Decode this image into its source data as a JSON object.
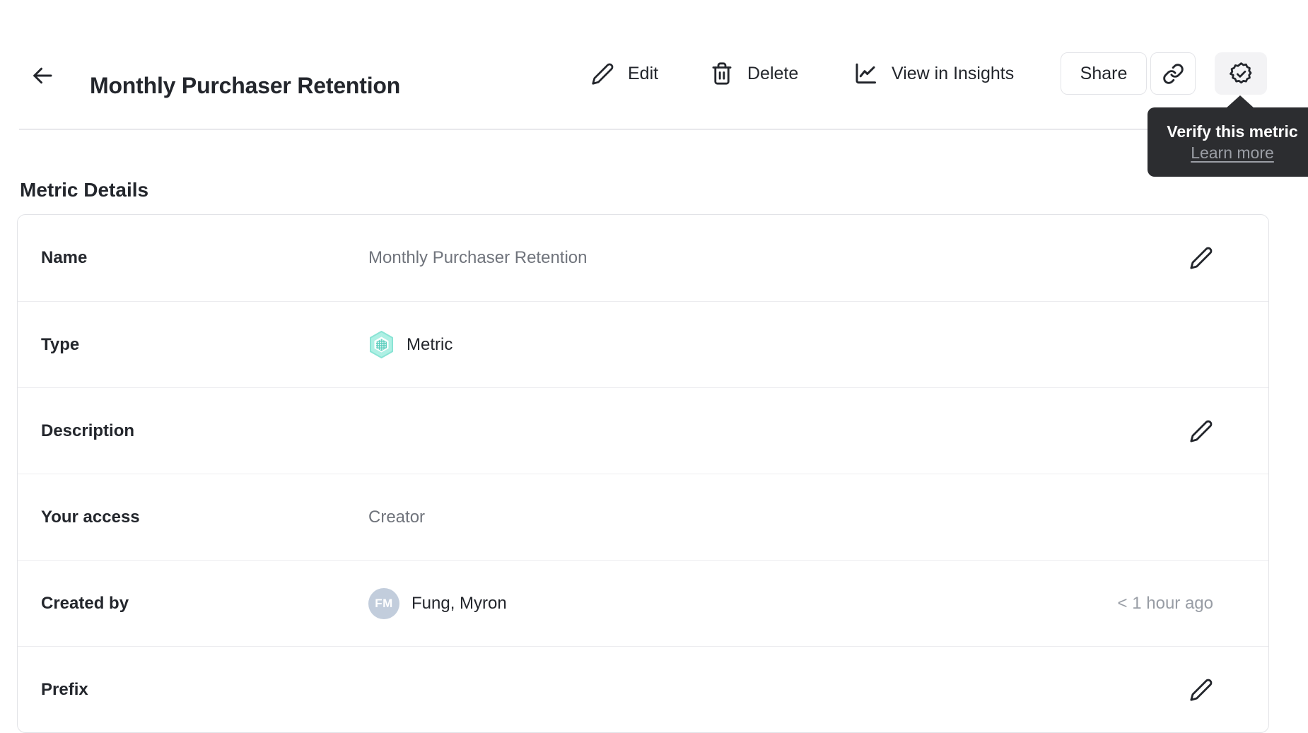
{
  "header": {
    "title": "Monthly Purchaser Retention",
    "actions": {
      "edit": "Edit",
      "delete": "Delete",
      "view_in_insights": "View in Insights",
      "share": "Share"
    }
  },
  "tooltip": {
    "title": "Verify this metric",
    "link": "Learn more"
  },
  "section": {
    "title": "Metric Details"
  },
  "details": {
    "rows": [
      {
        "label": "Name",
        "value": "Monthly Purchaser Retention"
      },
      {
        "label": "Type",
        "value": "Metric",
        "icon": "metric-hexagon-icon"
      },
      {
        "label": "Description",
        "value": ""
      },
      {
        "label": "Your access",
        "value": "Creator"
      },
      {
        "label": "Created by",
        "value": "Fung, Myron",
        "avatar_initials": "FM",
        "timestamp": "< 1 hour ago"
      },
      {
        "label": "Prefix",
        "value": ""
      }
    ]
  },
  "colors": {
    "text_primary": "#23262c",
    "text_secondary": "#70747c",
    "text_muted": "#989da5",
    "tooltip_background": "#2c2d30",
    "avatar_background": "#c2cddc",
    "metric_icon_teal": "#aef0e4",
    "metric_icon_teal_dark": "#5ecfbf",
    "verify_button_background": "#f3f3f5",
    "divider": "#e8e8ec"
  }
}
